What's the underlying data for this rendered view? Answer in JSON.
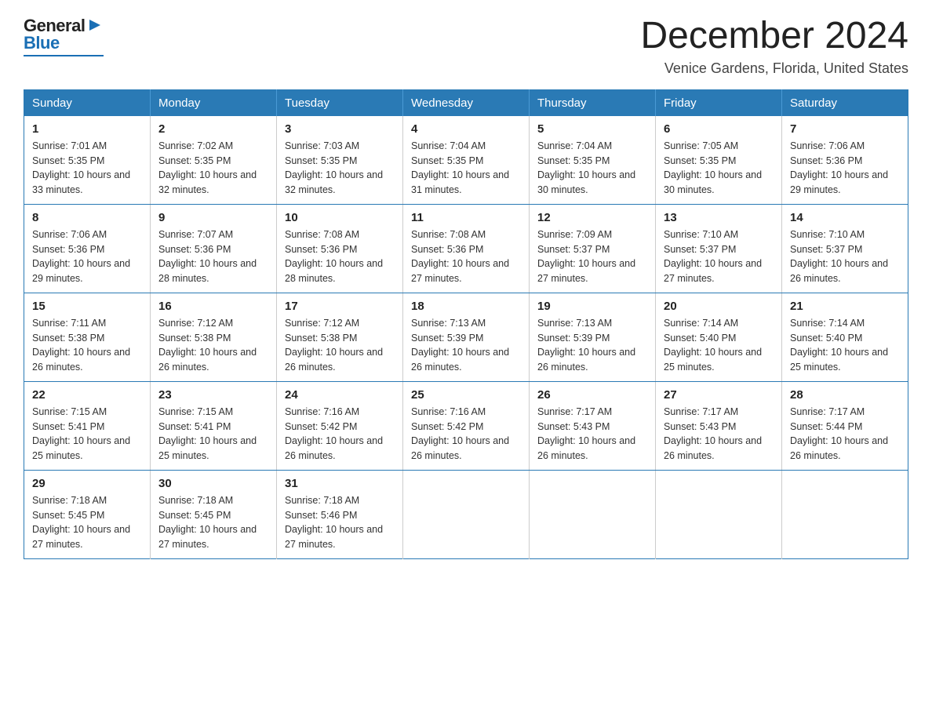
{
  "header": {
    "logo": {
      "general": "General",
      "blue": "Blue",
      "arrow": "▶"
    },
    "title": "December 2024",
    "subtitle": "Venice Gardens, Florida, United States"
  },
  "days_of_week": [
    "Sunday",
    "Monday",
    "Tuesday",
    "Wednesday",
    "Thursday",
    "Friday",
    "Saturday"
  ],
  "weeks": [
    [
      {
        "day": "1",
        "sunrise": "7:01 AM",
        "sunset": "5:35 PM",
        "daylight": "10 hours and 33 minutes."
      },
      {
        "day": "2",
        "sunrise": "7:02 AM",
        "sunset": "5:35 PM",
        "daylight": "10 hours and 32 minutes."
      },
      {
        "day": "3",
        "sunrise": "7:03 AM",
        "sunset": "5:35 PM",
        "daylight": "10 hours and 32 minutes."
      },
      {
        "day": "4",
        "sunrise": "7:04 AM",
        "sunset": "5:35 PM",
        "daylight": "10 hours and 31 minutes."
      },
      {
        "day": "5",
        "sunrise": "7:04 AM",
        "sunset": "5:35 PM",
        "daylight": "10 hours and 30 minutes."
      },
      {
        "day": "6",
        "sunrise": "7:05 AM",
        "sunset": "5:35 PM",
        "daylight": "10 hours and 30 minutes."
      },
      {
        "day": "7",
        "sunrise": "7:06 AM",
        "sunset": "5:36 PM",
        "daylight": "10 hours and 29 minutes."
      }
    ],
    [
      {
        "day": "8",
        "sunrise": "7:06 AM",
        "sunset": "5:36 PM",
        "daylight": "10 hours and 29 minutes."
      },
      {
        "day": "9",
        "sunrise": "7:07 AM",
        "sunset": "5:36 PM",
        "daylight": "10 hours and 28 minutes."
      },
      {
        "day": "10",
        "sunrise": "7:08 AM",
        "sunset": "5:36 PM",
        "daylight": "10 hours and 28 minutes."
      },
      {
        "day": "11",
        "sunrise": "7:08 AM",
        "sunset": "5:36 PM",
        "daylight": "10 hours and 27 minutes."
      },
      {
        "day": "12",
        "sunrise": "7:09 AM",
        "sunset": "5:37 PM",
        "daylight": "10 hours and 27 minutes."
      },
      {
        "day": "13",
        "sunrise": "7:10 AM",
        "sunset": "5:37 PM",
        "daylight": "10 hours and 27 minutes."
      },
      {
        "day": "14",
        "sunrise": "7:10 AM",
        "sunset": "5:37 PM",
        "daylight": "10 hours and 26 minutes."
      }
    ],
    [
      {
        "day": "15",
        "sunrise": "7:11 AM",
        "sunset": "5:38 PM",
        "daylight": "10 hours and 26 minutes."
      },
      {
        "day": "16",
        "sunrise": "7:12 AM",
        "sunset": "5:38 PM",
        "daylight": "10 hours and 26 minutes."
      },
      {
        "day": "17",
        "sunrise": "7:12 AM",
        "sunset": "5:38 PM",
        "daylight": "10 hours and 26 minutes."
      },
      {
        "day": "18",
        "sunrise": "7:13 AM",
        "sunset": "5:39 PM",
        "daylight": "10 hours and 26 minutes."
      },
      {
        "day": "19",
        "sunrise": "7:13 AM",
        "sunset": "5:39 PM",
        "daylight": "10 hours and 26 minutes."
      },
      {
        "day": "20",
        "sunrise": "7:14 AM",
        "sunset": "5:40 PM",
        "daylight": "10 hours and 25 minutes."
      },
      {
        "day": "21",
        "sunrise": "7:14 AM",
        "sunset": "5:40 PM",
        "daylight": "10 hours and 25 minutes."
      }
    ],
    [
      {
        "day": "22",
        "sunrise": "7:15 AM",
        "sunset": "5:41 PM",
        "daylight": "10 hours and 25 minutes."
      },
      {
        "day": "23",
        "sunrise": "7:15 AM",
        "sunset": "5:41 PM",
        "daylight": "10 hours and 25 minutes."
      },
      {
        "day": "24",
        "sunrise": "7:16 AM",
        "sunset": "5:42 PM",
        "daylight": "10 hours and 26 minutes."
      },
      {
        "day": "25",
        "sunrise": "7:16 AM",
        "sunset": "5:42 PM",
        "daylight": "10 hours and 26 minutes."
      },
      {
        "day": "26",
        "sunrise": "7:17 AM",
        "sunset": "5:43 PM",
        "daylight": "10 hours and 26 minutes."
      },
      {
        "day": "27",
        "sunrise": "7:17 AM",
        "sunset": "5:43 PM",
        "daylight": "10 hours and 26 minutes."
      },
      {
        "day": "28",
        "sunrise": "7:17 AM",
        "sunset": "5:44 PM",
        "daylight": "10 hours and 26 minutes."
      }
    ],
    [
      {
        "day": "29",
        "sunrise": "7:18 AM",
        "sunset": "5:45 PM",
        "daylight": "10 hours and 27 minutes."
      },
      {
        "day": "30",
        "sunrise": "7:18 AM",
        "sunset": "5:45 PM",
        "daylight": "10 hours and 27 minutes."
      },
      {
        "day": "31",
        "sunrise": "7:18 AM",
        "sunset": "5:46 PM",
        "daylight": "10 hours and 27 minutes."
      },
      null,
      null,
      null,
      null
    ]
  ],
  "labels": {
    "sunrise_prefix": "Sunrise: ",
    "sunset_prefix": "Sunset: ",
    "daylight_prefix": "Daylight: "
  }
}
